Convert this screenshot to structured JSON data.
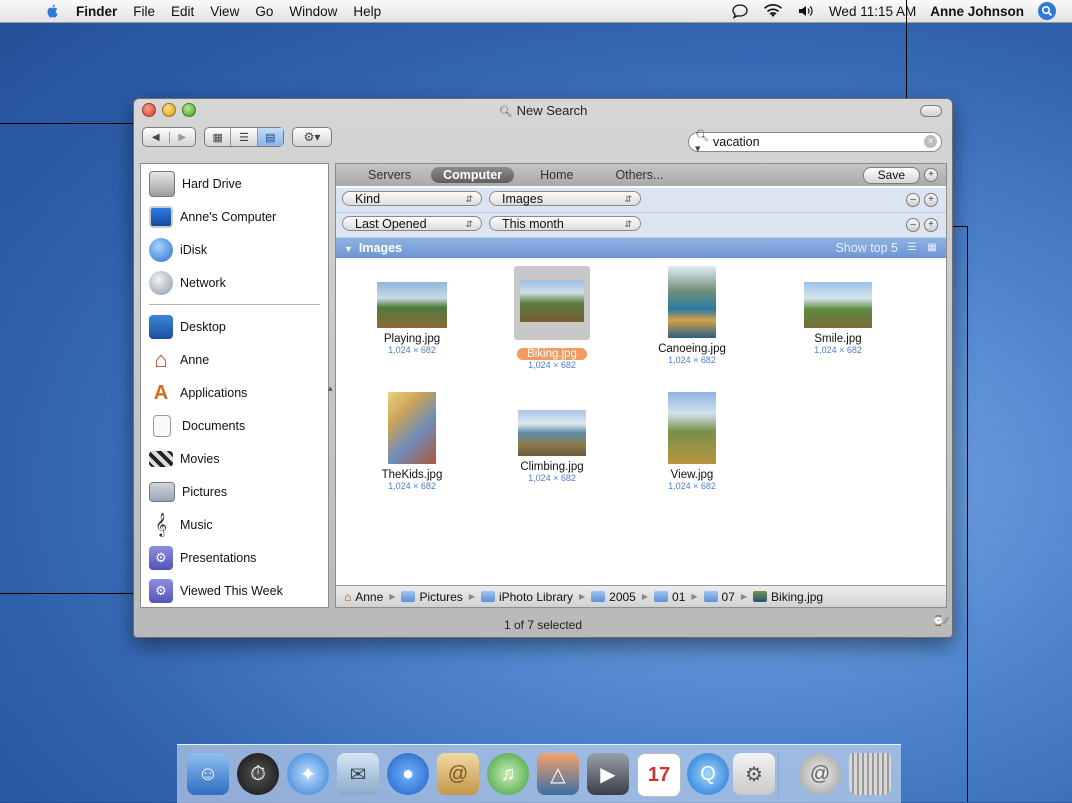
{
  "menubar": {
    "app": "Finder",
    "items": [
      "File",
      "Edit",
      "View",
      "Go",
      "Window",
      "Help"
    ],
    "clock": "Wed 11:15 AM",
    "user": "Anne Johnson"
  },
  "window": {
    "title": "New Search",
    "search_value": "vacation",
    "scopes": [
      "Servers",
      "Computer",
      "Home",
      "Others..."
    ],
    "selected_scope": "Computer",
    "save_label": "Save",
    "criteria": [
      {
        "attribute": "Kind",
        "value": "Images"
      },
      {
        "attribute": "Last Opened",
        "value": "This month"
      }
    ],
    "group": {
      "label": "Images",
      "show_top": "Show top 5"
    },
    "files": [
      {
        "name": "Playing.jpg",
        "dims": "1,024 × 682"
      },
      {
        "name": "Biking.jpg",
        "dims": "1,024 × 682",
        "selected": true
      },
      {
        "name": "Canoeing.jpg",
        "dims": "1,024 × 682"
      },
      {
        "name": "Smile.jpg",
        "dims": "1,024 × 682"
      },
      {
        "name": "TheKids.jpg",
        "dims": "1,024 × 682"
      },
      {
        "name": "Climbing.jpg",
        "dims": "1,024 × 682"
      },
      {
        "name": "View.jpg",
        "dims": "1,024 × 682"
      }
    ],
    "path": [
      "Anne",
      "Pictures",
      "iPhoto Library",
      "2005",
      "01",
      "07",
      "Biking.jpg"
    ],
    "status": "1 of 7 selected"
  },
  "sidebar": {
    "devices": [
      "Hard Drive",
      "Anne's Computer",
      "iDisk",
      "Network"
    ],
    "places": [
      "Desktop",
      "Anne",
      "Applications",
      "Documents",
      "Movies",
      "Pictures",
      "Music",
      "Presentations",
      "Viewed This Week"
    ]
  },
  "colors": {
    "selection_orange": "#f29a5f",
    "group_blue": "#7fa3da",
    "criteria_bg": "#dbe5f2"
  }
}
